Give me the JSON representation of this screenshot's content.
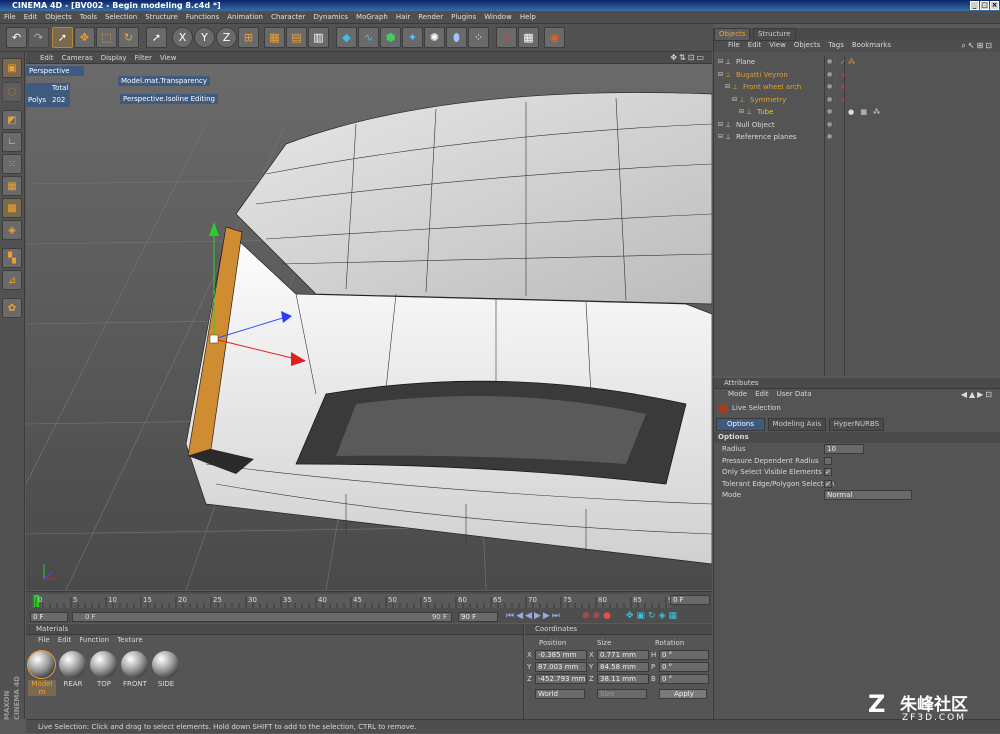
{
  "app": {
    "title": "CINEMA 4D - [BV002 - Begin modeling 8.c4d *]",
    "menu": [
      "File",
      "Edit",
      "Objects",
      "Tools",
      "Selection",
      "Structure",
      "Functions",
      "Animation",
      "Character",
      "Dynamics",
      "MoGraph",
      "Hair",
      "Render",
      "Plugins",
      "Window",
      "Help"
    ]
  },
  "toolbar": {
    "icons": [
      "undo-icon",
      "redo-icon",
      "live-selection-icon",
      "move-icon",
      "scale-icon",
      "rotate-icon",
      "last-tool-icon",
      "x-axis-icon",
      "y-axis-icon",
      "z-axis-icon",
      "world-coords-icon",
      "render-view-icon",
      "render-picture-viewer-icon",
      "render-settings-icon",
      "cube-icon",
      "spline-icon",
      "nurbs-icon",
      "deformer-icon",
      "scene-icon",
      "light-icon",
      "particle-icon",
      "help-icon",
      "layers-icon",
      "web-icon"
    ],
    "axis_labels": [
      "X",
      "Y",
      "Z"
    ]
  },
  "viewport": {
    "menu": [
      "Edit",
      "Cameras",
      "Display",
      "Filter",
      "View"
    ],
    "camera_label": "Perspective",
    "stats": {
      "total_label": "Total",
      "polys_label": "Polys",
      "polys_value": "202"
    },
    "hud": [
      "Model.mat.Transparency",
      "Perspective.Isoline Editing"
    ]
  },
  "timeline": {
    "ticks": [
      "0",
      "5",
      "10",
      "15",
      "20",
      "25",
      "30",
      "35",
      "40",
      "45",
      "50",
      "55",
      "60",
      "65",
      "70",
      "75",
      "80",
      "85",
      "90"
    ],
    "current_frame": "0 F",
    "start_frame": "0 F",
    "scrub_start": "0 F",
    "scrub_end": "90 F",
    "end_frame": "90 F"
  },
  "materials": {
    "header": "Materials",
    "menu": [
      "File",
      "Edit",
      "Function",
      "Texture"
    ],
    "items": [
      "Model m",
      "REAR",
      "TOP",
      "FRONT",
      "SIDE"
    ]
  },
  "coordinates": {
    "header": "Coordinates",
    "columns": [
      "Position",
      "Size",
      "Rotation"
    ],
    "rows": [
      {
        "axis": "X",
        "pos": "-0.385 mm",
        "size_axis": "X",
        "size": "0.771 mm",
        "rot_axis": "H",
        "rot": "0 °"
      },
      {
        "axis": "Y",
        "pos": "87.003 mm",
        "size_axis": "Y",
        "size": "84.58 mm",
        "rot_axis": "P",
        "rot": "0 °"
      },
      {
        "axis": "Z",
        "pos": "-452.793 mm",
        "size_axis": "Z",
        "size": "38.11 mm",
        "rot_axis": "B",
        "rot": "0 °"
      }
    ],
    "space": "World",
    "size_mode": "Size",
    "apply_label": "Apply"
  },
  "status": "Live Selection: Click and drag to select elements. Hold down SHIFT to add to the selection, CTRL to remove.",
  "objects": {
    "tabs": [
      "Objects",
      "Structure"
    ],
    "menu": [
      "File",
      "Edit",
      "View",
      "Objects",
      "Tags",
      "Bookmarks"
    ],
    "tree": [
      {
        "name": "Plane",
        "indent": 0,
        "color": "#d8d8d8"
      },
      {
        "name": "Bugatti Veyron",
        "indent": 0,
        "color": "#e0a030"
      },
      {
        "name": "Front wheel arch",
        "indent": 1,
        "color": "#e0a030"
      },
      {
        "name": "Symmetry",
        "indent": 2,
        "color": "#e0a030"
      },
      {
        "name": "Tube",
        "indent": 3,
        "color": "#f0c030"
      },
      {
        "name": "Null Object",
        "indent": 0,
        "color": "#d8d8d8"
      },
      {
        "name": "Reference planes",
        "indent": 0,
        "color": "#d8d8d8"
      }
    ]
  },
  "attributes": {
    "header": "Attributes",
    "menu": [
      "Mode",
      "Edit",
      "User Data"
    ],
    "tool_name": "Live Selection",
    "tabs": [
      "Options",
      "Modeling Axis",
      "HyperNURBS"
    ],
    "section": "Options",
    "fields": [
      {
        "label": "Radius",
        "value": "10"
      },
      {
        "label": "Pressure Dependent Radius",
        "checked": false
      },
      {
        "label": "Only Select Visible Elements",
        "checked": true
      },
      {
        "label": "Tolerant Edge/Polygon Selection",
        "checked": true
      },
      {
        "label": "Mode",
        "value": "Normal"
      }
    ]
  },
  "branding": {
    "maxon": "MAXON",
    "product": "CINEMA 4D",
    "watermark_cn": "朱峰社区",
    "watermark_url": "ZF3D.COM"
  },
  "colors": {
    "accent": "#f0a030",
    "selection_blue": "#3e5a7e"
  }
}
